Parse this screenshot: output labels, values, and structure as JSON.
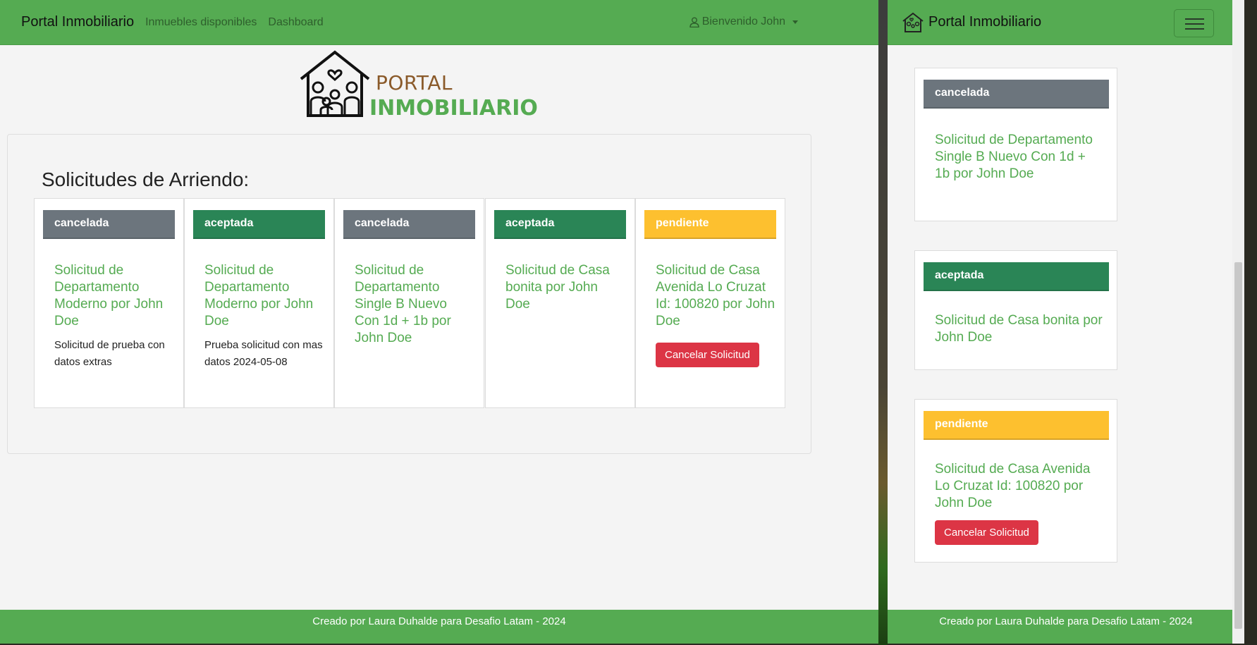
{
  "app": {
    "brand": "Portal Inmobiliario",
    "nav_items": [
      "Inmuebles disponibles",
      "Dashboard"
    ],
    "user_menu": "Bienvenido John"
  },
  "logo": {
    "line1": "PORTAL",
    "line2": "INMOBILIARIO"
  },
  "main": {
    "heading": "Solicitudes de Arriendo:",
    "requests": [
      {
        "status": "cancelada",
        "title": "Solicitud de Departamento Moderno por John Doe",
        "description": "Solicitud de prueba con datos extras"
      },
      {
        "status": "aceptada",
        "title": "Solicitud de Departamento Moderno por John Doe",
        "description": "Prueba solicitud con mas datos 2024-05-08"
      },
      {
        "status": "cancelada",
        "title": "Solicitud de Departamento Single B Nuevo Con 1d + 1b por John Doe",
        "description": ""
      },
      {
        "status": "aceptada",
        "title": "Solicitud de Casa bonita por John Doe",
        "description": ""
      },
      {
        "status": "pendiente",
        "title": "Solicitud de Casa Avenida Lo Cruzat Id: 100820 por John Doe",
        "description": "",
        "action": "Cancelar Solicitud"
      }
    ]
  },
  "mobile": {
    "requests": [
      {
        "status": "cancelada",
        "title": "Solicitud de Departamento Single B Nuevo Con 1d + 1b por John Doe"
      },
      {
        "status": "aceptada",
        "title": "Solicitud de Casa bonita por John Doe"
      },
      {
        "status": "pendiente",
        "title": "Solicitud de Casa Avenida Lo Cruzat Id: 100820 por John Doe",
        "action": "Cancelar Solicitud"
      }
    ]
  },
  "footer": {
    "text": "Creado por Laura Duhalde para Desafio Latam - 2024"
  },
  "colors": {
    "navbar": "#55ab52",
    "cancelada": "#6c757d",
    "aceptada": "#2a8556",
    "pendiente": "#fdc02f",
    "danger": "#dc3545"
  }
}
